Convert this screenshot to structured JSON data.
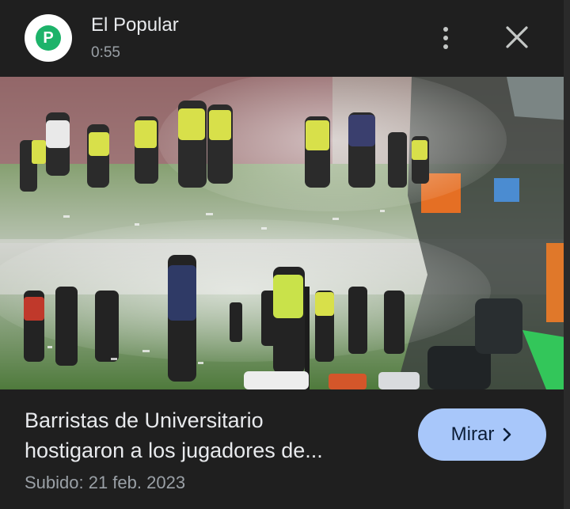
{
  "header": {
    "channel_name": "El Popular",
    "duration": "0:55",
    "avatar_letter": "P",
    "avatar_color": "#1db36a"
  },
  "video": {
    "title_line1": "Barristas de Universitario",
    "title_line2": "hostigaron a los jugadores de...",
    "upload_date": "Subido: 21 feb. 2023"
  },
  "actions": {
    "watch_label": "Mirar",
    "watch_icon": "chevron-right-icon",
    "more_icon": "more-vert-icon",
    "close_icon": "close-icon",
    "lens_icon": "google-lens-icon"
  },
  "colors": {
    "background": "#1f1f1f",
    "button_bg": "#a8c7fa",
    "secondary_text": "#9aa0a6"
  }
}
